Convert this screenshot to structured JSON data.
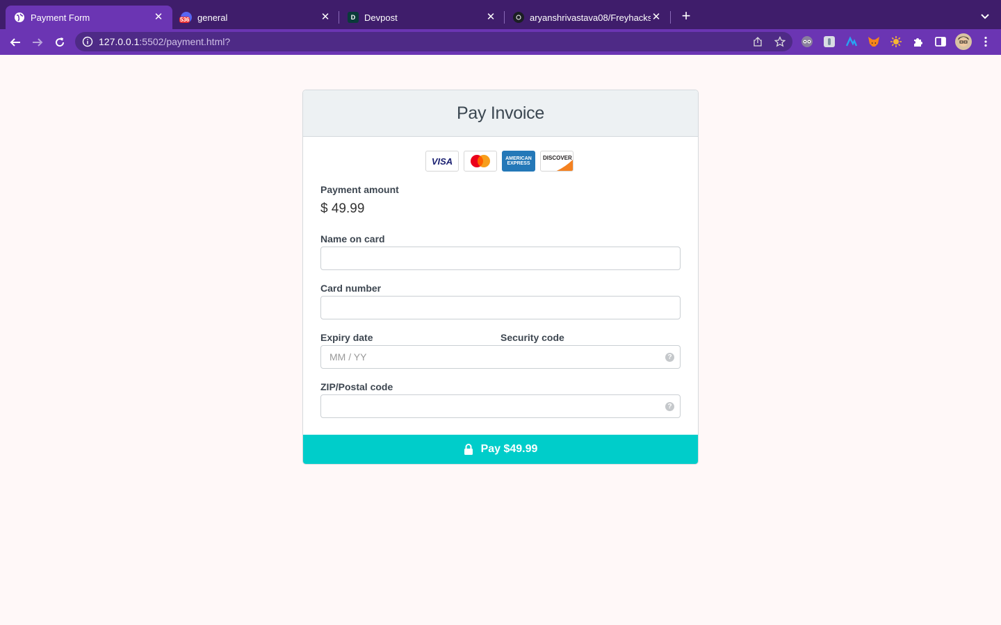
{
  "browser": {
    "tabs": [
      {
        "title": "Payment Form",
        "favicon": "globe-icon"
      },
      {
        "title": "general",
        "favicon": "discord-icon",
        "badge": "536"
      },
      {
        "title": "Devpost",
        "favicon": "devpost-icon",
        "letter": "D"
      },
      {
        "title": "aryanshrivastava08/Freyhacks",
        "favicon": "github-icon"
      }
    ],
    "url_host": "127.0.0.1",
    "url_path": ":5502/payment.html?",
    "colors": {
      "tabstrip": "#3f1d6b",
      "toolbar": "#6b35b3"
    }
  },
  "page": {
    "title": "Pay Invoice",
    "card_logos": [
      "VISA",
      "MasterCard",
      "AMERICAN EXPRESS",
      "DISCOVER"
    ],
    "amount_label": "Payment amount",
    "amount": "$ 49.99",
    "name_label": "Name on card",
    "card_label": "Card number",
    "expiry_label": "Expiry date",
    "expiry_placeholder": "MM / YY",
    "security_label": "Security code",
    "zip_label": "ZIP/Postal code",
    "pay_button": "Pay $49.99",
    "accent": "#00cdca"
  }
}
